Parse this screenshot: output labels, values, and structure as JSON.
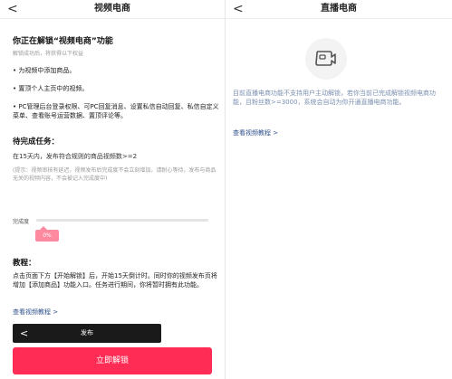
{
  "left": {
    "nav_back": "<",
    "title": "视频电商",
    "heading": "你正在解锁“视频电商”功能",
    "subheading": "解锁成功后，将获得以下权益",
    "benefits": [
      "• 为视频中添加商品。",
      "• 置顶个人主页中的视频。",
      "• PC管理后台登录权限、可PC回复消息、设置私信自动回复、私信自定义菜单、查看账号运营数据、置顶评论等。"
    ],
    "task_heading": "待完成任务：",
    "task_text": "在15天内，发布符合规则的商品视频数>=2",
    "task_tip": "(提示：视频审核有延迟，视频发布后完成度不会立刻增加，请耐心等待，发布与商品无关的视频内容，不会被记入完成度中)",
    "progress_label": "完成度",
    "progress_percent": "0%",
    "progress_value": 0,
    "tutorial_heading": "教程：",
    "tutorial_text": "点击页面下方【开始解锁】后，开始15天倒计时。同时你的视频发布页将增加【添加商品】功能入口。任务进行期间，你将暂时拥有此功能。",
    "video_tutorial_link": "查看视频教程 >",
    "publish_back": "<",
    "publish_label": "发布",
    "unlock_button": "立即解锁"
  },
  "right": {
    "nav_back": "<",
    "title": "直播电商",
    "icon": "live-video-icon",
    "description": "目前直播电商功能不支持用户主动解锁，若你当前已完成解锁视频电商功能，且粉丝数>=3000，系统会自动为你开通直播电商功能。",
    "video_tutorial_link": "查看视频教程 >"
  },
  "colors": {
    "accent": "#ff2d55",
    "progress_badge": "#ff8aa0",
    "link": "#2d4f8a"
  }
}
